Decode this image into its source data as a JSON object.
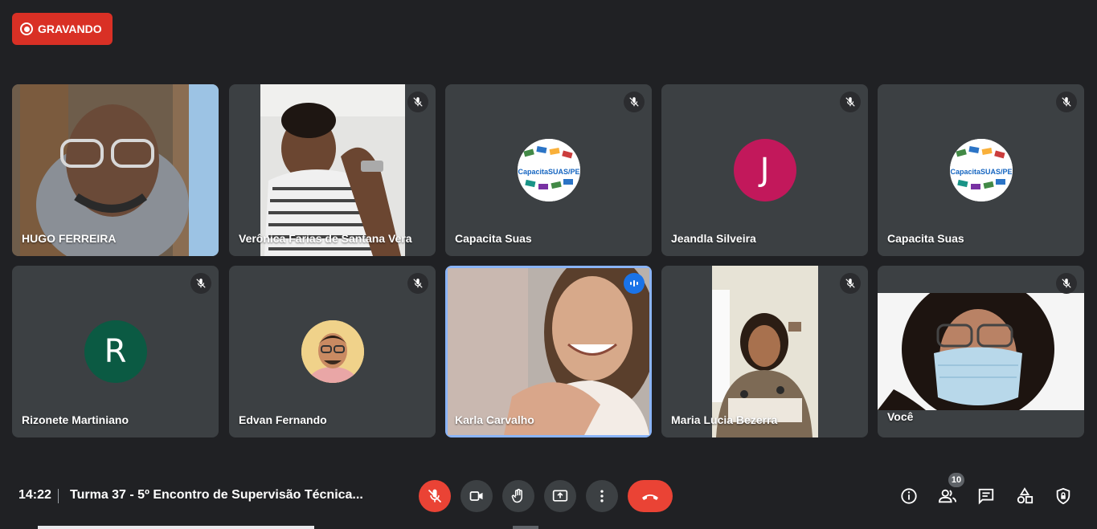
{
  "recording": {
    "label": "GRAVANDO"
  },
  "participants": [
    {
      "name": "HUGO FERREIRA",
      "type": "video"
    },
    {
      "name": "Verônica Farias de Santana Vera",
      "type": "video",
      "muted": true
    },
    {
      "name": "Capacita Suas",
      "type": "logo",
      "muted": true,
      "logo_text": "CapacitaSUAS/PE"
    },
    {
      "name": "Jeandla Silveira",
      "type": "initial",
      "initial": "J",
      "color": "#c2185b",
      "muted": true
    },
    {
      "name": "Capacita Suas",
      "type": "logo",
      "muted": true,
      "logo_text": "CapacitaSUAS/PE"
    },
    {
      "name": "Rizonete Martiniano",
      "type": "initial",
      "initial": "R",
      "color": "#0b5a43",
      "muted": true
    },
    {
      "name": "Edvan Fernando",
      "type": "photo",
      "muted": true
    },
    {
      "name": "Karla Carvalho",
      "type": "video",
      "speaking": true
    },
    {
      "name": "Maria Lucia Bezerra",
      "type": "video",
      "muted": true
    },
    {
      "name": "Você",
      "type": "video",
      "muted": true
    }
  ],
  "meeting": {
    "time": "14:22",
    "title": "Turma 37 - 5º Encontro de Supervisão Técnica..."
  },
  "people_count": "10",
  "colors": {
    "background": "#202124",
    "tile": "#3c4043",
    "danger": "#ea4335",
    "accent": "#1a73e8"
  }
}
